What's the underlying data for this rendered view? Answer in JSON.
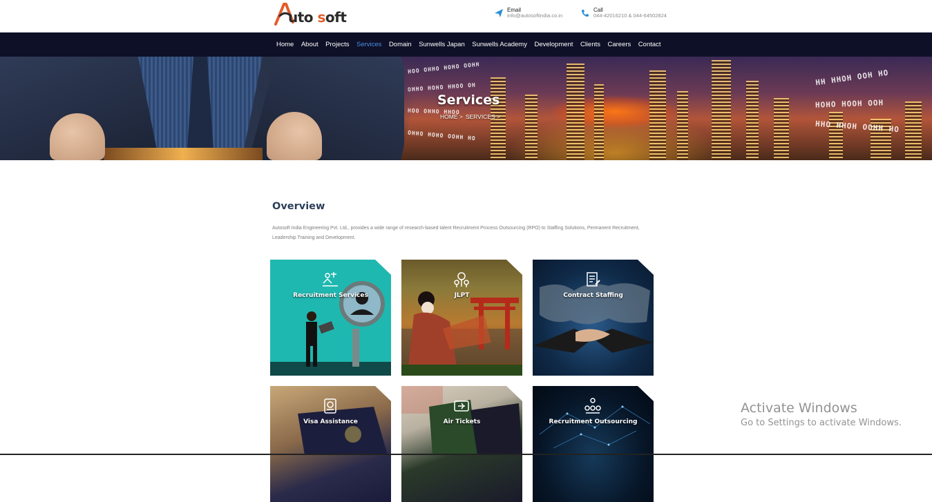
{
  "header": {
    "logo_prefix": "A",
    "logo_rest_1": "uto ",
    "logo_accent": "s",
    "logo_rest_2": "oft",
    "email": {
      "label": "Email",
      "value": "info@autosoftindia.co.in",
      "icon": "paper-plane-icon"
    },
    "call": {
      "label": "Call",
      "value": "044-42016210 & 044-64502824",
      "icon": "phone-icon"
    }
  },
  "nav": {
    "items": [
      {
        "label": "Home"
      },
      {
        "label": "About"
      },
      {
        "label": "Projects"
      },
      {
        "label": "Services",
        "active": true
      },
      {
        "label": "Domain"
      },
      {
        "label": "Sunwells Japan"
      },
      {
        "label": "Sunwells Academy"
      },
      {
        "label": "Development"
      },
      {
        "label": "Clients"
      },
      {
        "label": "Careers"
      },
      {
        "label": "Contact"
      }
    ],
    "active_color": "#4a90e2",
    "bg_color": "#0e1027"
  },
  "hero": {
    "title": "Services",
    "breadcrumb": [
      "HOME >",
      "SERVICES >"
    ]
  },
  "overview": {
    "title": "Overview",
    "text": "Autosoft India Engineering Pvt. Ltd., provides a wide range of research-based talent Recruitment Process Outsourcing (RPO) to Staffing Solutions, Permanent Recruitment, Leadership Training and Development."
  },
  "services": [
    {
      "label": "Recruitment Services",
      "icon": "recruitment-icon"
    },
    {
      "label": "JLPT",
      "icon": "language-icon"
    },
    {
      "label": "Contract Staffing",
      "icon": "contract-icon"
    },
    {
      "label": "Visa Assistance",
      "icon": "visa-icon"
    },
    {
      "label": "Air Tickets",
      "icon": "ticket-icon"
    },
    {
      "label": "Recruitment Outsourcing",
      "icon": "team-icon"
    }
  ],
  "watermark": {
    "line1": "Activate Windows",
    "line2": "Go to Settings to activate Windows."
  }
}
